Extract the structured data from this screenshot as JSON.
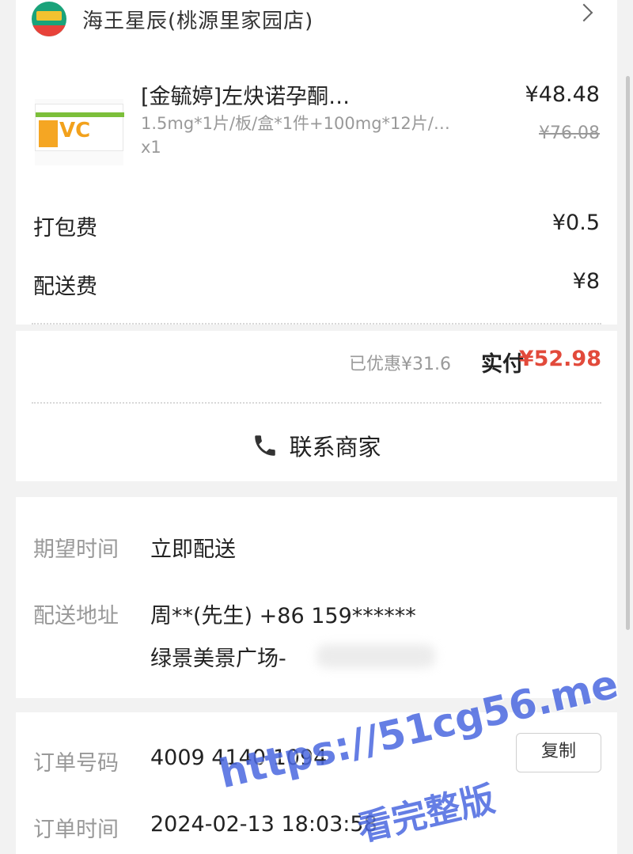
{
  "store": {
    "name": "海王星辰(桃源里家园店)"
  },
  "product": {
    "title": "[金毓婷]左炔诺孕酮…",
    "spec": "1.5mg*1片/板/盒*1件+100mg*12片/…",
    "qty": "x1",
    "price": "¥48.48",
    "original_price": "¥76.08"
  },
  "fees": {
    "packing_label": "打包费",
    "packing_value": "¥0.5",
    "delivery_label": "配送费",
    "delivery_value": "¥8"
  },
  "total": {
    "discount": "已优惠¥31.6",
    "paid_label": "实付",
    "paid_value": "¥52.98"
  },
  "contact": {
    "label": "联系商家"
  },
  "delivery": {
    "time_label": "期望时间",
    "time_value": "立即配送",
    "address_label": "配送地址",
    "address_line1": "周**(先生)  +86 159******",
    "address_line2": "绿景美景广场-"
  },
  "order": {
    "number_label": "订单号码",
    "number_value": "4009 4140 1094",
    "copy_label": "复制",
    "time_label": "订单时间",
    "time_value": "2024-02-13 18:03:58"
  },
  "watermark": {
    "url": "https://51cg56.me",
    "subtitle": "看完整版"
  },
  "colors": {
    "accent_red": "#e24a3b",
    "watermark_blue": "#4b68e0"
  }
}
